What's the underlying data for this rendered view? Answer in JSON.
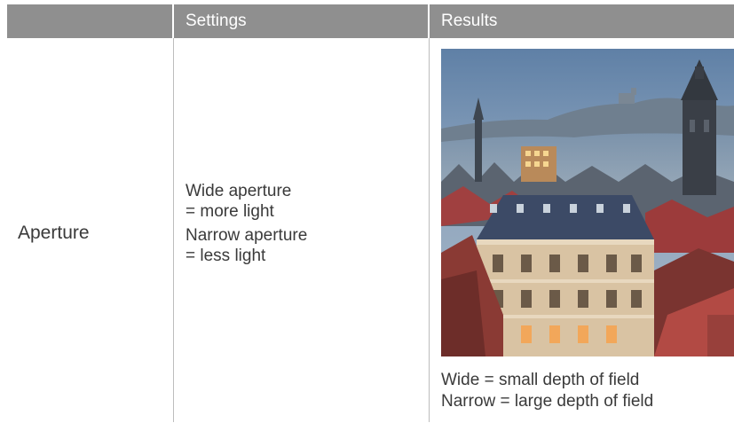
{
  "table": {
    "headers": [
      "",
      "Settings",
      "Results"
    ],
    "rows": [
      {
        "label": "Aperture",
        "settings": [
          "Wide aperture",
          "= more light",
          "Narrow aperture",
          "= less light"
        ],
        "results": {
          "image": "city-rooftops-photo",
          "caption": [
            "Wide = small depth of field",
            "Narrow = large depth of field"
          ]
        }
      }
    ]
  },
  "colors": {
    "header_bg": "#8f8f8f",
    "header_text": "#ffffff",
    "body_text": "#3a3a3a",
    "divider": "#bdbdbd"
  }
}
